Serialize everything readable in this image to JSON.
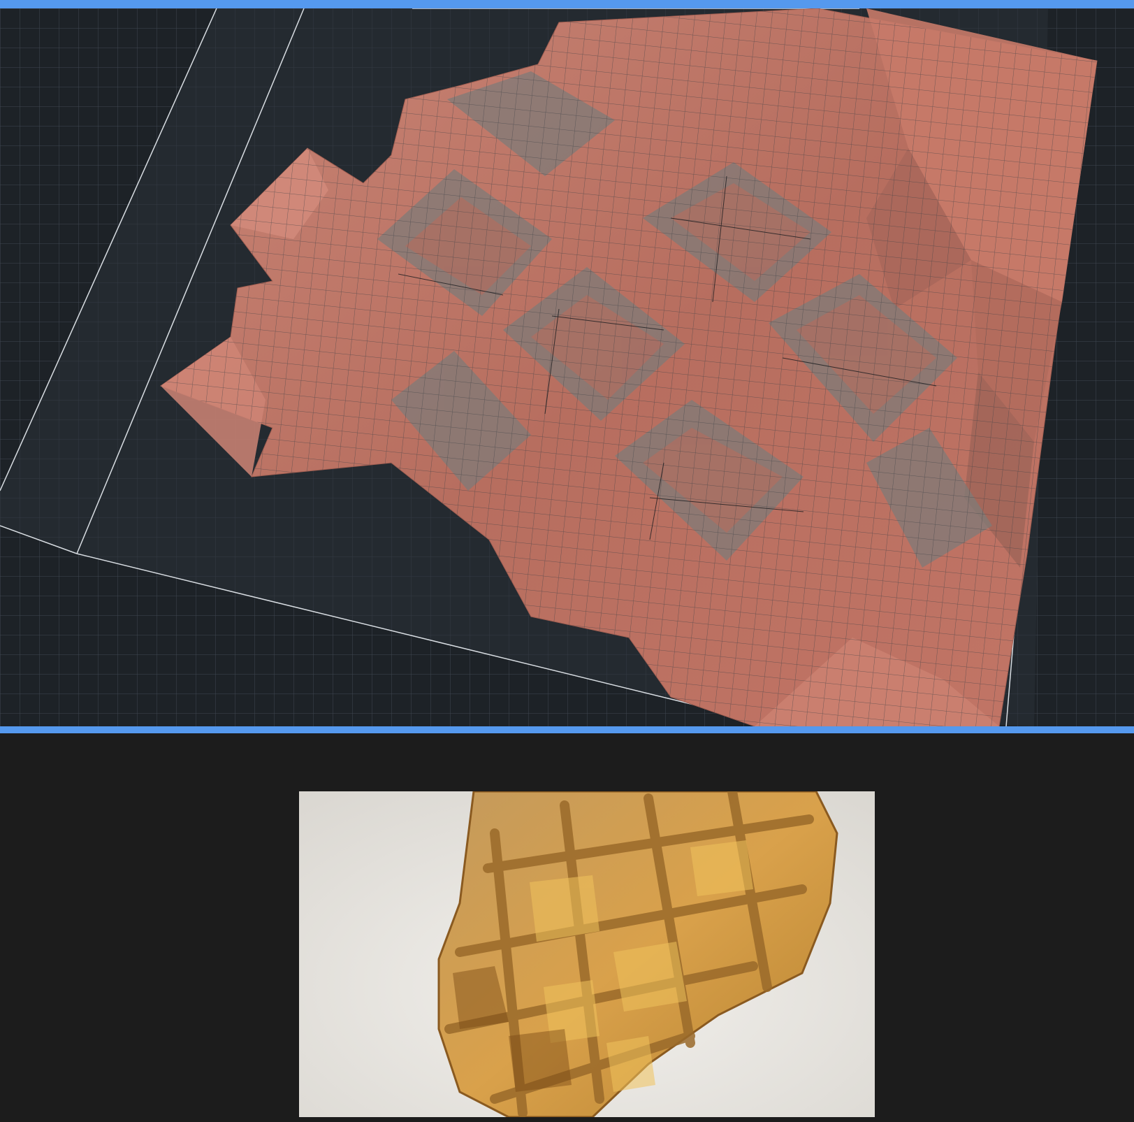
{
  "viewport": {
    "kind": "3d-viewport",
    "colors": {
      "frame": "#5599ee",
      "background": "#1d2227",
      "grid": "#5c6670",
      "mesh": "#c27566",
      "mesh_shadow": "#8f6a62",
      "bounds": "#d8dde2"
    },
    "objects": [
      {
        "name": "reconstructed-waffle-mesh"
      },
      {
        "name": "ground-grid"
      },
      {
        "name": "bounding-box"
      }
    ]
  },
  "preview": {
    "kind": "source-photo",
    "subject_icon": "waffle-photo",
    "colors": {
      "plate": "#ebe8e3",
      "waffle_light": "#d9a14b",
      "waffle_dark": "#8a5a20"
    }
  }
}
